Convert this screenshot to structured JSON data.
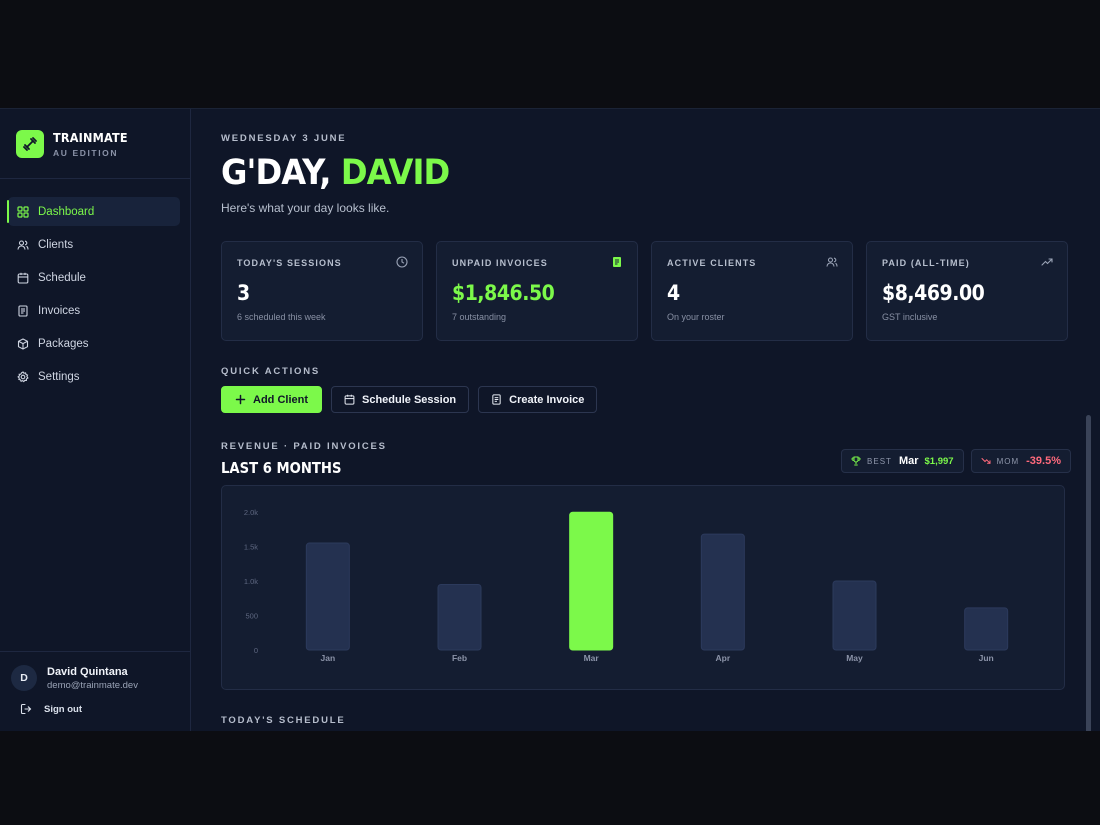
{
  "brand": {
    "name": "TRAINMATE",
    "subtitle": "AU EDITION"
  },
  "sidebar": {
    "items": [
      {
        "label": "Dashboard",
        "icon": "grid-icon",
        "active": true
      },
      {
        "label": "Clients",
        "icon": "users-icon"
      },
      {
        "label": "Schedule",
        "icon": "calendar-icon"
      },
      {
        "label": "Invoices",
        "icon": "receipt-icon"
      },
      {
        "label": "Packages",
        "icon": "package-icon"
      },
      {
        "label": "Settings",
        "icon": "gear-icon"
      }
    ],
    "user": {
      "initial": "D",
      "name": "David Quintana",
      "email": "demo@trainmate.dev"
    },
    "signout_label": "Sign out"
  },
  "header": {
    "date": "WEDNESDAY 3 JUNE",
    "greeting_prefix": "G'DAY, ",
    "greeting_name": "DAVID",
    "tagline": "Here's what your day looks like."
  },
  "stats": [
    {
      "label": "TODAY'S SESSIONS",
      "value": "3",
      "sub": "6 scheduled this week",
      "icon": "clock-icon"
    },
    {
      "label": "UNPAID INVOICES",
      "value": "$1,846.50",
      "sub": "7 outstanding",
      "icon": "receipt-icon"
    },
    {
      "label": "ACTIVE CLIENTS",
      "value": "4",
      "sub": "On your roster",
      "icon": "users-icon"
    },
    {
      "label": "PAID (ALL-TIME)",
      "value": "$8,469.00",
      "sub": "GST inclusive",
      "icon": "trending-up-icon"
    }
  ],
  "quick_actions": {
    "label": "QUICK ACTIONS",
    "buttons": [
      "Add Client",
      "Schedule Session",
      "Create Invoice"
    ]
  },
  "revenue": {
    "eyebrow": "REVENUE · PAID INVOICES",
    "title": "LAST 6 MONTHS",
    "best": {
      "label": "BEST",
      "month": "Mar",
      "amount": "$1,997"
    },
    "mom": {
      "label": "MOM",
      "change": "-39.5%"
    }
  },
  "schedule_label": "TODAY'S SCHEDULE",
  "colors": {
    "accent": "#7cf94a",
    "negative": "#ff6a7c",
    "bar": "#243150",
    "panel": "#141d31"
  },
  "chart_data": {
    "type": "bar",
    "categories": [
      "Jan",
      "Feb",
      "Mar",
      "Apr",
      "May",
      "Jun"
    ],
    "values": [
      1550,
      950,
      1997,
      1680,
      1000,
      610
    ],
    "highlight": "Mar",
    "ylim": [
      0,
      2000
    ],
    "yticks": [
      0,
      500,
      1000,
      1500,
      2000
    ],
    "ytick_labels": [
      "0",
      "500",
      "1.0k",
      "1.5k",
      "2.0k"
    ],
    "grid": false
  }
}
